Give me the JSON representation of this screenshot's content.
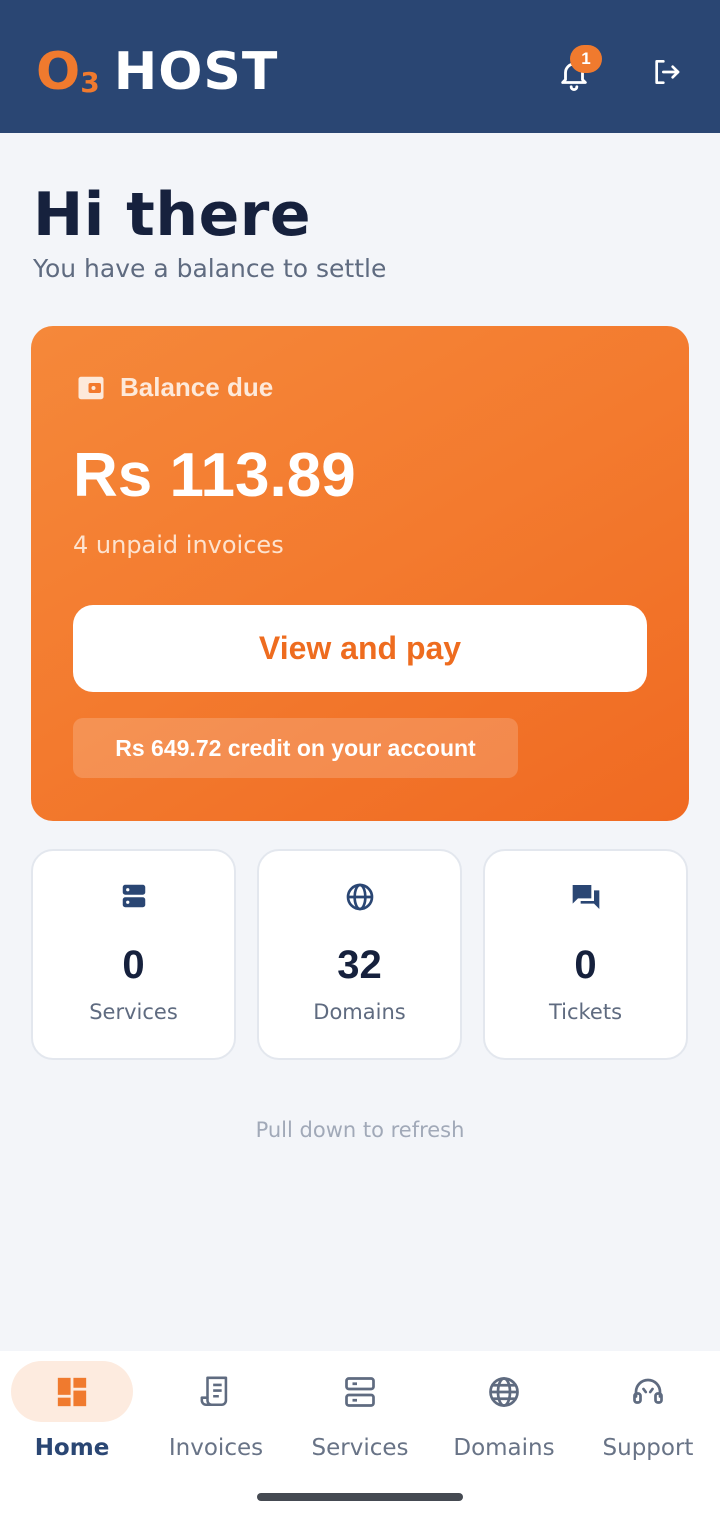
{
  "header": {
    "logo": {
      "o": "O",
      "sub": "3",
      "host": "HOST"
    },
    "notifications": {
      "icon": "bell-icon",
      "badge_count": "1"
    },
    "logout": {
      "icon": "logout-icon"
    }
  },
  "greeting": {
    "title": "Hi there",
    "subtitle": "You have a balance to settle"
  },
  "balance_card": {
    "icon": "wallet-icon",
    "label": "Balance due",
    "amount": "Rs 113.89",
    "unpaid": "4 unpaid invoices",
    "pay_button": "View and pay",
    "credit": "Rs 649.72 credit on your account"
  },
  "stats": [
    {
      "icon": "server-icon",
      "value": "0",
      "label": "Services"
    },
    {
      "icon": "globe-icon",
      "value": "32",
      "label": "Domains"
    },
    {
      "icon": "chat-icon",
      "value": "0",
      "label": "Tickets"
    }
  ],
  "refresh_hint": "Pull down to refresh",
  "nav": [
    {
      "icon": "dashboard-icon",
      "label": "Home",
      "active": true
    },
    {
      "icon": "receipt-icon",
      "label": "Invoices"
    },
    {
      "icon": "server-icon",
      "label": "Services"
    },
    {
      "icon": "globe-icon",
      "label": "Domains"
    },
    {
      "icon": "headset-icon",
      "label": "Support"
    }
  ],
  "colors": {
    "header": "#2a4673",
    "accent": "#f07a2e",
    "background": "#f3f5f9",
    "navy_text": "#16213d"
  }
}
